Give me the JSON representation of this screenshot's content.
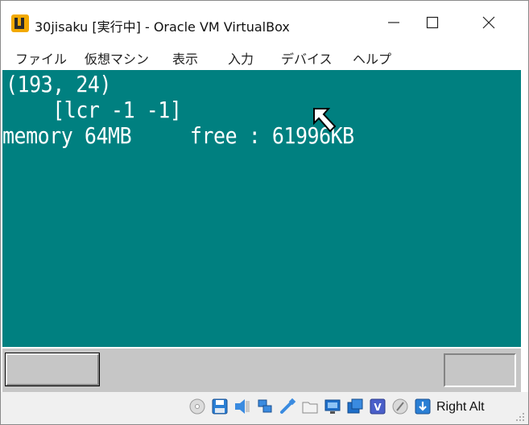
{
  "window": {
    "title": "30jisaku [実行中] - Oracle VM VirtualBox"
  },
  "menu": {
    "items": [
      {
        "label": "ファイル"
      },
      {
        "label": "仮想マシン"
      },
      {
        "label": "表示"
      },
      {
        "label": "入力"
      },
      {
        "label": "デバイス"
      },
      {
        "label": "ヘルプ"
      }
    ]
  },
  "guest": {
    "lines": [
      "(193, 24)",
      "    [lcr -1 -1]",
      "memory 64MB     free : 61996KB"
    ],
    "background_color": "#008080",
    "taskbar_color": "#c6c6c6"
  },
  "statusbar": {
    "icons": [
      "optical-drive-icon",
      "floppy-drive-icon",
      "audio-icon",
      "network-icon",
      "usb-icon",
      "shared-folders-icon",
      "display-icon",
      "video-capture-icon",
      "cpu-vtx-icon",
      "mouse-integration-icon",
      "keyboard-capture-icon"
    ],
    "host_key": "Right Alt"
  }
}
